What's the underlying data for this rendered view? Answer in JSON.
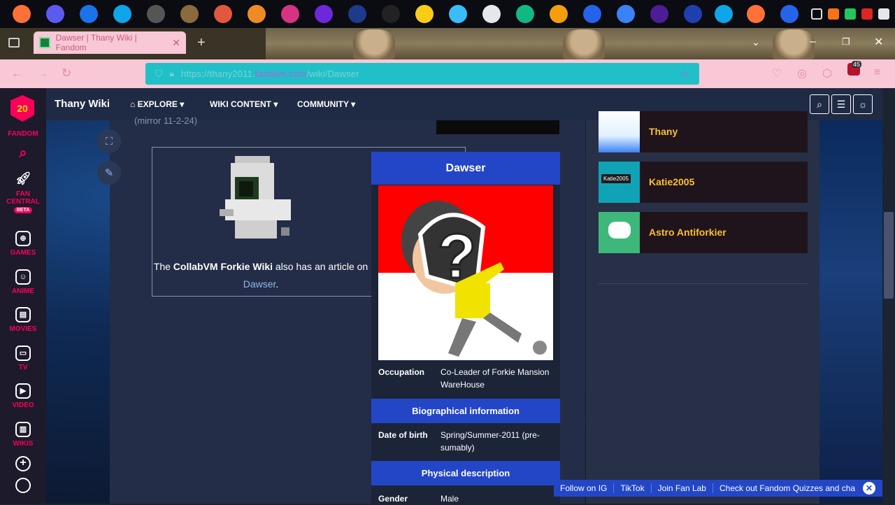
{
  "browser": {
    "tab_title": "Dawser | Thany Wiki | Fandom",
    "url_prefix": "https://thany2011.",
    "url_domain": "fandom.com",
    "url_suffix": "/wiki/Dawser",
    "extension_badge": "45"
  },
  "fandom_rail": {
    "logo_number": "20",
    "brand": "FANDOM",
    "items": [
      {
        "label": "FAN CENTRAL",
        "badge": "BETA"
      },
      {
        "label": "GAMES"
      },
      {
        "label": "ANIME"
      },
      {
        "label": "MOVIES"
      },
      {
        "label": "TV"
      },
      {
        "label": "VIDEO"
      },
      {
        "label": "WIKIS"
      }
    ]
  },
  "wiki_header": {
    "name": "Thany Wiki",
    "nav": [
      "EXPLORE",
      "WIKI CONTENT",
      "COMMUNITY"
    ]
  },
  "article": {
    "mirror_note": "(mirror 11-2-24)",
    "interwiki": {
      "prefix": "The",
      "wiki_name": "CollabVM Forkie Wiki",
      "middle": "also has an article on",
      "link": "Dawser",
      "suffix": "."
    }
  },
  "infobox": {
    "title": "Dawser",
    "occupation_label": "Occupation",
    "occupation_value": "Co-Leader of Forkie Mansion WareHouse",
    "bio_heading": "Biographical information",
    "dob_label": "Date of birth",
    "dob_value": "Spring/Summer-2011 (pre-sumably)",
    "physical_heading": "Physical description",
    "gender_label": "Gender",
    "gender_value": "Male"
  },
  "sidebar": {
    "cards": [
      {
        "name": "Thany"
      },
      {
        "name": "Katie2005",
        "thumb_text": "Katie2005"
      },
      {
        "name": "Astro Antiforkier"
      }
    ]
  },
  "bottom_bar": {
    "items": [
      "Follow on IG",
      "TikTok",
      "Join Fan Lab",
      "Check out Fandom Quizzes and cha"
    ]
  },
  "colors": {
    "fandom_pink": "#fa005a",
    "infobox_blue": "#2346c7",
    "sidebar_gold": "#fbc02d"
  }
}
